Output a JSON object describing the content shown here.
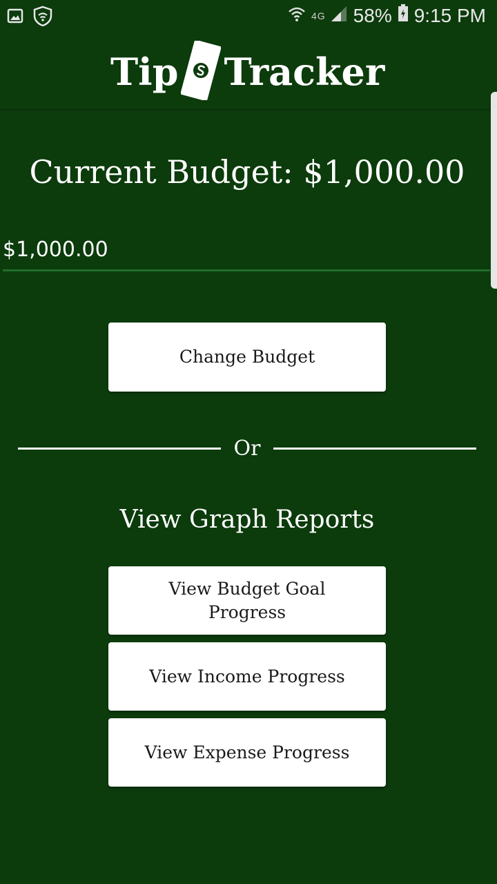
{
  "status_bar": {
    "signal_label": "4G",
    "battery": "58%",
    "time": "9:15 PM",
    "icons": [
      "gallery-icon",
      "shield-wifi-icon",
      "wifi-icon",
      "cell-signal-icon",
      "battery-icon"
    ]
  },
  "header": {
    "logo_left": "Tip",
    "logo_right": "Tracker",
    "logo_icon": "money-bill-icon"
  },
  "main": {
    "title": "Current Budget: $1,000.00",
    "budget_input_value": "$1,000.00",
    "change_budget_label": "Change Budget",
    "divider_label": "Or",
    "reports_heading": "View Graph Reports",
    "report_buttons": [
      "View Budget Goal Progress",
      "View Income Progress",
      "View Expense Progress"
    ]
  },
  "colors": {
    "background": "#0c3b0c",
    "button": "#ffffff",
    "input_underline": "#1f6e2a",
    "text": "#ffffff"
  }
}
